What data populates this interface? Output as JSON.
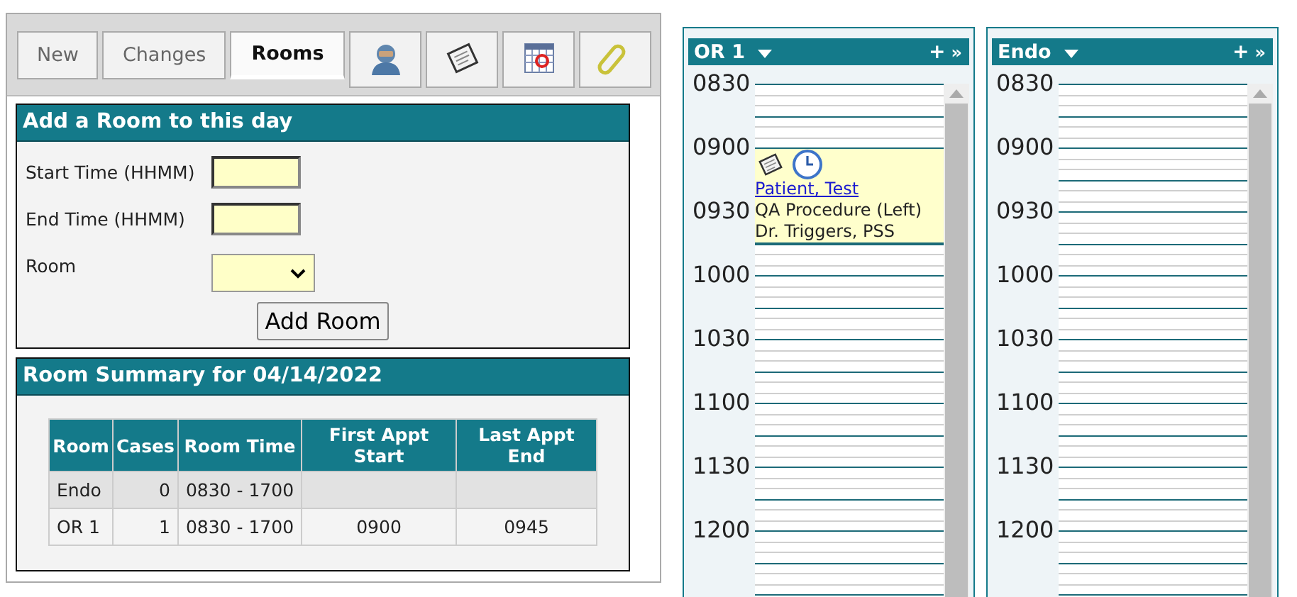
{
  "tabs": [
    {
      "kind": "text",
      "label": "New",
      "selected": false
    },
    {
      "kind": "text",
      "label": "Changes",
      "selected": false
    },
    {
      "kind": "text",
      "label": "Rooms",
      "selected": true
    },
    {
      "kind": "icon",
      "selected": false
    },
    {
      "kind": "icon",
      "selected": false
    },
    {
      "kind": "icon",
      "selected": false
    },
    {
      "kind": "icon",
      "selected": false
    }
  ],
  "add_room": {
    "title": "Add a Room to this day",
    "fields": [
      {
        "kind": "text",
        "label": "Start Time (HHMM)"
      },
      {
        "kind": "text",
        "label": "End Time (HHMM)"
      },
      {
        "kind": "select",
        "label": "Room"
      }
    ],
    "button": "Add Room"
  },
  "summary": {
    "title": "Room Summary for 04/14/2022",
    "columns": [
      "Room",
      "Cases",
      "Room Time",
      "First Appt Start",
      "Last Appt End"
    ],
    "rows": [
      {
        "room": "Endo",
        "cases": "0",
        "room_time": "0830 - 1700"
      },
      {
        "room": "OR 1",
        "cases": "1",
        "room_time": "0830 - 1700",
        "first_appt_start": "0900",
        "last_appt_end": "0945"
      }
    ]
  },
  "schedule_columns": [
    {
      "title": "OR 1",
      "add": "+",
      "more": "»",
      "slots": [
        {
          "time": "0830"
        },
        {
          "time": "0900",
          "appointment": {
            "patient": "Patient, Test",
            "procedure": "QA Procedure (Left)",
            "provider": "Dr. Triggers, PSS"
          }
        },
        {
          "time": "0930"
        },
        {
          "time": "1000"
        },
        {
          "time": "1030"
        },
        {
          "time": "1100"
        },
        {
          "time": "1130"
        },
        {
          "time": "1200"
        }
      ]
    },
    {
      "title": "Endo",
      "add": "+",
      "more": "»",
      "slots": [
        {
          "time": "0830"
        },
        {
          "time": "0900"
        },
        {
          "time": "0930"
        },
        {
          "time": "1000"
        },
        {
          "time": "1030"
        },
        {
          "time": "1100"
        },
        {
          "time": "1130"
        },
        {
          "time": "1200"
        }
      ]
    }
  ]
}
